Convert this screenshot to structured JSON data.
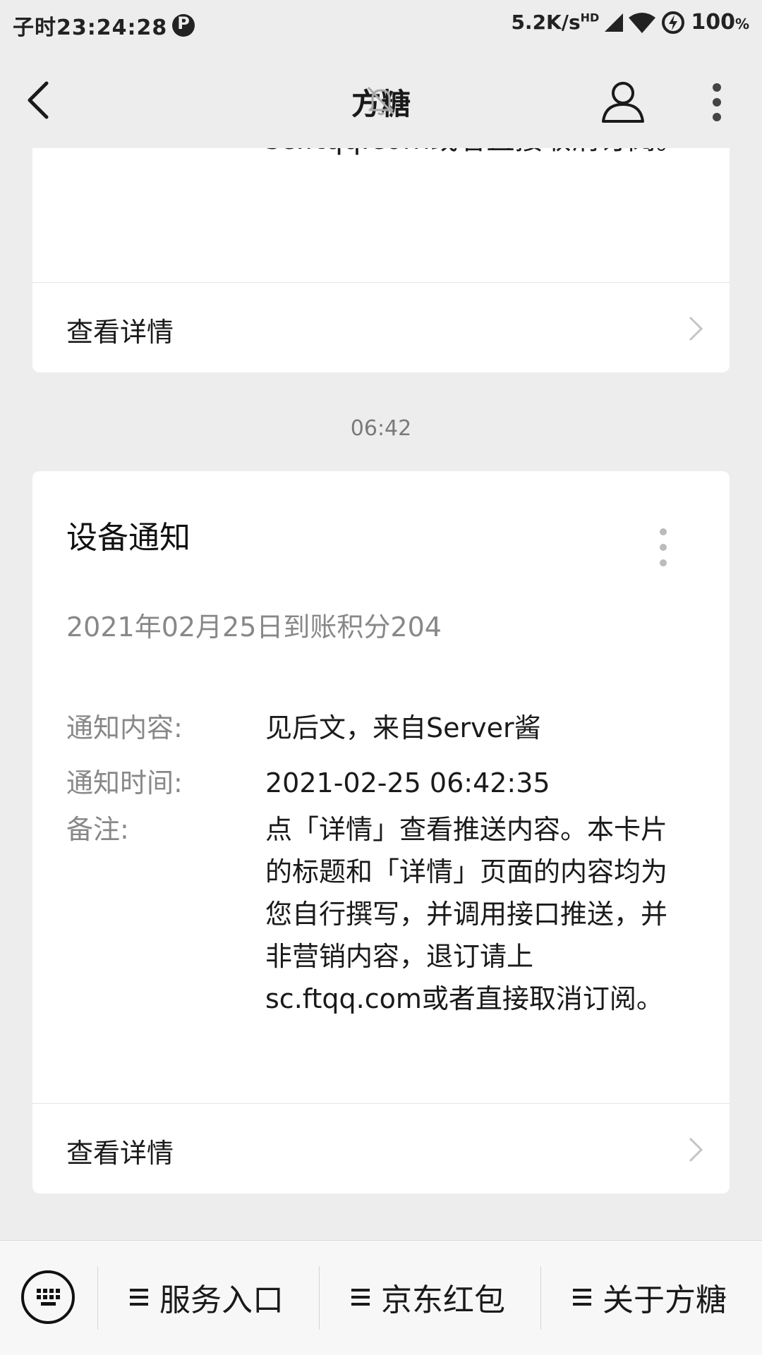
{
  "status_bar": {
    "time": "子时23:24:28",
    "app_badge": "P",
    "net_speed": "5.2K/s",
    "net_badge": "HD",
    "battery": "100",
    "battery_unit": "%"
  },
  "nav": {
    "title": "方糖"
  },
  "prev_card": {
    "remark_tail": "sc.ftqq.com或者直接取消订阅。",
    "detail_label": "查看详情"
  },
  "timestamp": "06:42",
  "card": {
    "title": "设备通知",
    "subtitle": "2021年02月25日到账积分204",
    "fields": [
      {
        "key": "通知内容:",
        "value": "见后文，来自Server酱"
      },
      {
        "key": "通知时间:",
        "value": "2021-02-25 06:42:35"
      },
      {
        "key": "备注:",
        "value": "点「详情」查看推送内容。本卡片的标题和「详情」页面的内容均为您自行撰写，并调用接口推送，并非营销内容，退订请上sc.ftqq.com或者直接取消订阅。"
      }
    ],
    "detail_label": "查看详情"
  },
  "bottom_menu": {
    "items": [
      "服务入口",
      "京东红包",
      "关于方糖"
    ]
  },
  "colors": {
    "background": "#ededed",
    "card": "#ffffff",
    "muted_text": "#888888"
  }
}
